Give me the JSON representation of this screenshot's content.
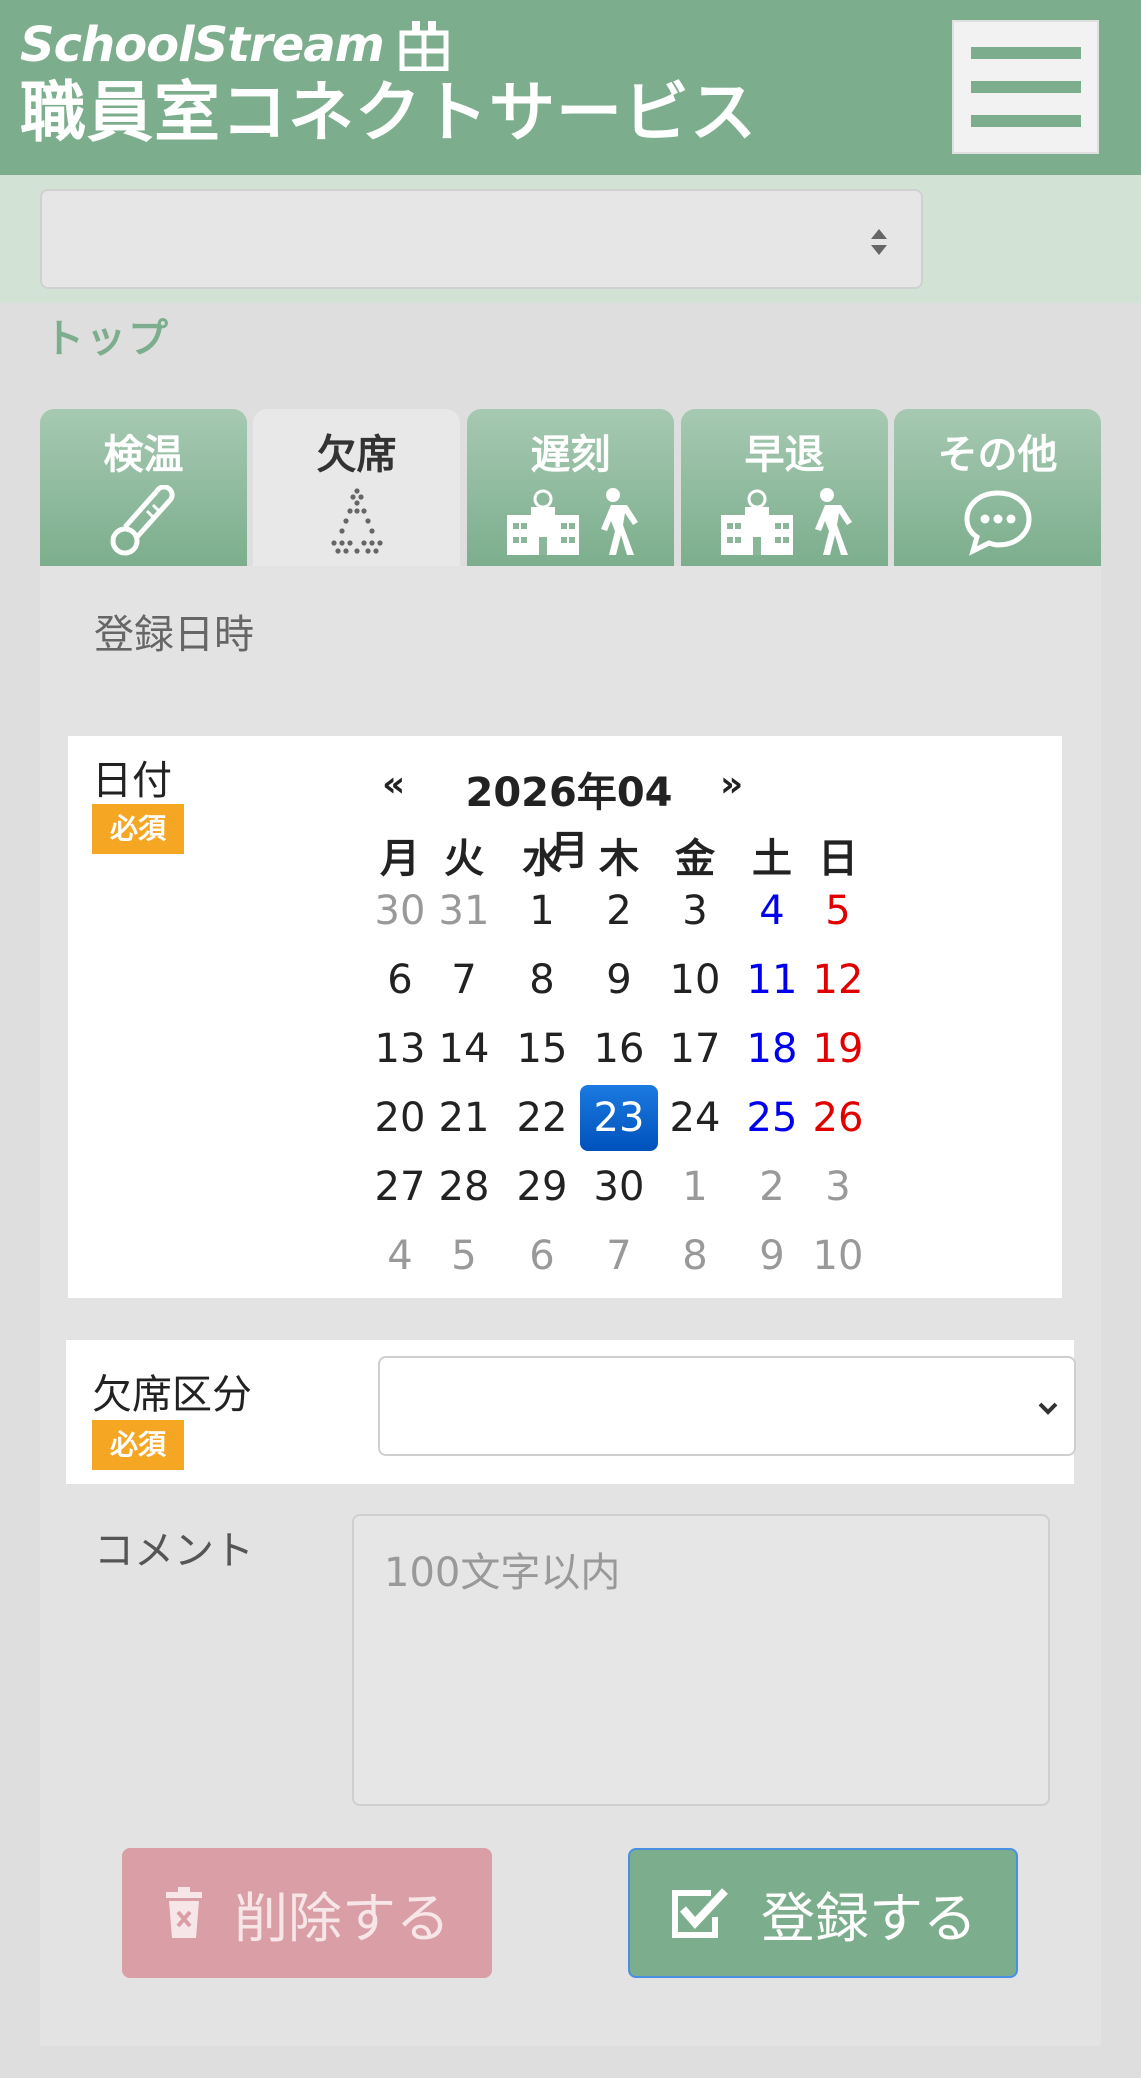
{
  "header": {
    "logo_text": "SchoolStream",
    "service_name": "職員室コネクトサービス"
  },
  "breadcrumb": {
    "label": "トップ"
  },
  "school_select": {
    "value": ""
  },
  "tabs": [
    {
      "label": "検温",
      "icon": "thermometer-icon"
    },
    {
      "label": "欠席",
      "icon": "absence-dots-icon",
      "active": true
    },
    {
      "label": "遅刻",
      "icon": "school-walk-icon"
    },
    {
      "label": "早退",
      "icon": "school-walk-icon"
    },
    {
      "label": "その他",
      "icon": "chat-bubble-icon"
    }
  ],
  "form": {
    "registered_at_label": "登録日時",
    "date_label": "日付",
    "required_badge": "必須",
    "absence_type_label": "欠席区分",
    "absence_type_value": "",
    "comment_label": "コメント",
    "comment_placeholder": "100文字以内",
    "delete_button": "削除する",
    "register_button": "登録する"
  },
  "calendar": {
    "title": "2026年04月",
    "prev": "«",
    "next": "»",
    "weekdays": [
      "月",
      "火",
      "水",
      "木",
      "金",
      "土",
      "日"
    ],
    "selected": "23",
    "weeks": [
      [
        [
          "30",
          "other"
        ],
        [
          "31",
          "other"
        ],
        [
          "1",
          ""
        ],
        [
          "2",
          ""
        ],
        [
          "3",
          ""
        ],
        [
          "4",
          "sat"
        ],
        [
          "5",
          "sun"
        ]
      ],
      [
        [
          "6",
          ""
        ],
        [
          "7",
          ""
        ],
        [
          "8",
          ""
        ],
        [
          "9",
          ""
        ],
        [
          "10",
          ""
        ],
        [
          "11",
          "sat"
        ],
        [
          "12",
          "sun"
        ]
      ],
      [
        [
          "13",
          ""
        ],
        [
          "14",
          ""
        ],
        [
          "15",
          ""
        ],
        [
          "16",
          ""
        ],
        [
          "17",
          ""
        ],
        [
          "18",
          "sat"
        ],
        [
          "19",
          "sun"
        ]
      ],
      [
        [
          "20",
          ""
        ],
        [
          "21",
          ""
        ],
        [
          "22",
          ""
        ],
        [
          "23",
          "selected"
        ],
        [
          "24",
          ""
        ],
        [
          "25",
          "sat"
        ],
        [
          "26",
          "sun"
        ]
      ],
      [
        [
          "27",
          ""
        ],
        [
          "28",
          ""
        ],
        [
          "29",
          ""
        ],
        [
          "30",
          ""
        ],
        [
          "1",
          "other"
        ],
        [
          "2",
          "other"
        ],
        [
          "3",
          "other"
        ]
      ],
      [
        [
          "4",
          "other"
        ],
        [
          "5",
          "other"
        ],
        [
          "6",
          "other"
        ],
        [
          "7",
          "other"
        ],
        [
          "8",
          "other"
        ],
        [
          "9",
          "other"
        ],
        [
          "10",
          "other"
        ]
      ]
    ]
  },
  "colors": {
    "brand_green": "#7cae8d",
    "required_orange": "#f5a623",
    "saturday_blue": "#0000ee",
    "sunday_red": "#e00000",
    "selected_blue": "#0a63cc",
    "delete_pink": "#d99ea6"
  }
}
